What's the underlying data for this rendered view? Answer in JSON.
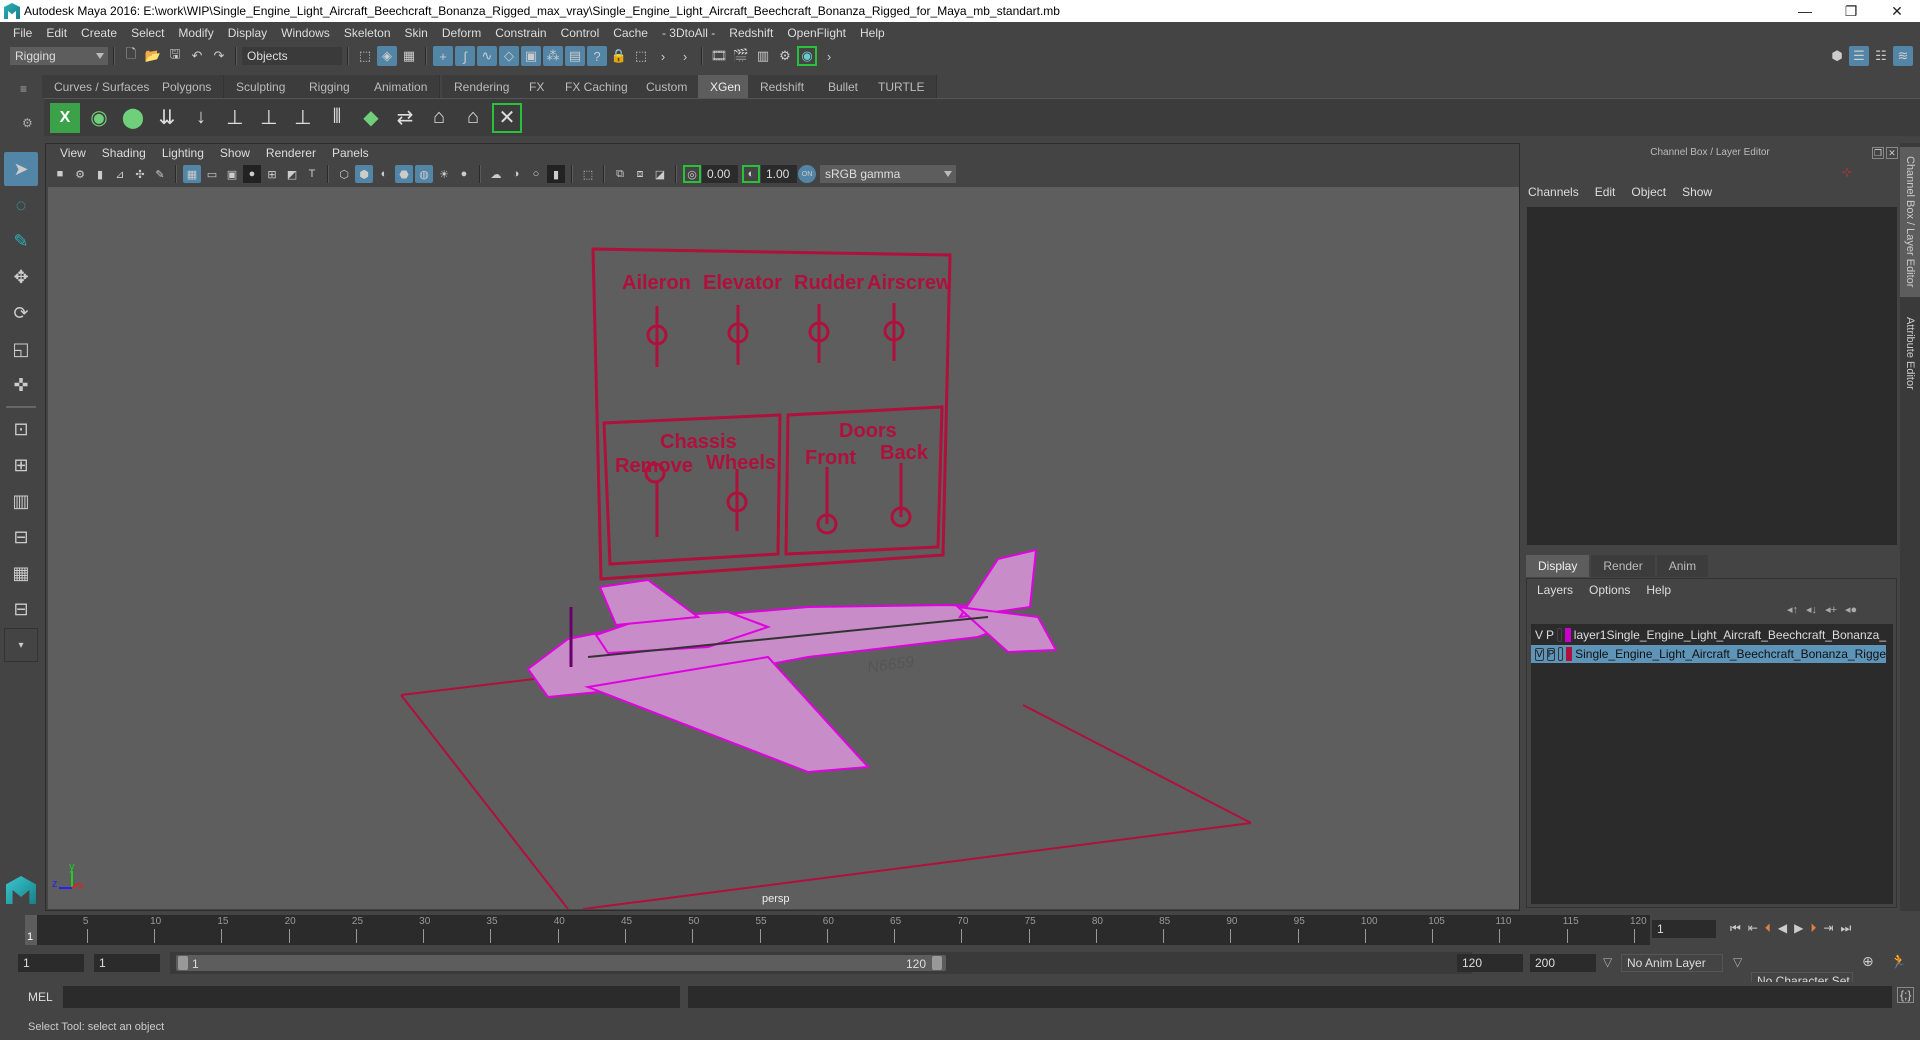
{
  "window": {
    "title": "Autodesk Maya 2016: E:\\work\\WIP\\Single_Engine_Light_Aircraft_Beechcraft_Bonanza_Rigged_max_vray\\Single_Engine_Light_Aircraft_Beechcraft_Bonanza_Rigged_for_Maya_mb_standart.mb",
    "minimize": "—",
    "restore": "❐",
    "close": "✕"
  },
  "menubar": [
    "File",
    "Edit",
    "Create",
    "Select",
    "Modify",
    "Display",
    "Windows",
    "Skeleton",
    "Skin",
    "Deform",
    "Constrain",
    "Control",
    "Cache",
    "- 3DtoAll -",
    "Redshift",
    "OpenFlight",
    "Help"
  ],
  "statusline": {
    "mode": "Rigging",
    "selection_mask": "Objects"
  },
  "shelf": {
    "tabs": [
      "Curves / Surfaces",
      "Polygons",
      "Sculpting",
      "Rigging",
      "Animation",
      "Rendering",
      "FX",
      "FX Caching",
      "Custom",
      "XGen",
      "Redshift",
      "Bullet",
      "TURTLE"
    ],
    "active_tab": "XGen",
    "icons": [
      "xgen-editor-icon",
      "xgen-preview-icon",
      "xgen-clear-icon",
      "add-guides-icon",
      "place-guides-icon",
      "add-guide-icon",
      "sculpt-guide-icon",
      "lock-guide-icon",
      "split-guides-icon",
      "density-icon",
      "flip-guides-icon",
      "select-guides-icon",
      "guide-cv-icon",
      "xgen-toggle-icon"
    ]
  },
  "panel": {
    "menus": [
      "View",
      "Shading",
      "Lighting",
      "Show",
      "Renderer",
      "Panels"
    ],
    "exposure": "0.00",
    "gamma": "1.00",
    "color_space": "sRGB gamma",
    "camera_label": "persp"
  },
  "scene": {
    "control_board": {
      "top_labels": [
        "Aileron",
        "Elevator",
        "Rudder",
        "Airscrew"
      ],
      "chassis_title": "Chassis",
      "chassis_labels": [
        "Remove",
        "Wheels"
      ],
      "doors_title": "Doors",
      "doors_labels": [
        "Front",
        "Back"
      ]
    },
    "tail_number": "N6659",
    "axis": {
      "x": "x",
      "y": "y",
      "z": "z"
    },
    "wire_color": "#b0103c",
    "mesh_color": "#e000e0"
  },
  "channel_box": {
    "title": "Channel Box / Layer Editor",
    "menus": [
      "Channels",
      "Edit",
      "Object",
      "Show"
    ]
  },
  "layer_editor": {
    "tabs": [
      "Display",
      "Render",
      "Anim"
    ],
    "active_tab": "Display",
    "menus": [
      "Layers",
      "Options",
      "Help"
    ],
    "layers": [
      {
        "v": "V",
        "p": "P",
        "color": "#cc00cc",
        "name": "layer1Single_Engine_Light_Aircraft_Beechcraft_Bonanza_",
        "selected": false
      },
      {
        "v": "V",
        "p": "P",
        "color": "#b0103c",
        "name": "Single_Engine_Light_Aircraft_Beechcraft_Bonanza_Rigge",
        "selected": true
      }
    ]
  },
  "side_tabs": [
    "Channel Box / Layer Editor",
    "Attribute Editor"
  ],
  "timeline": {
    "ticks": [
      "5",
      "10",
      "15",
      "20",
      "25",
      "30",
      "35",
      "40",
      "45",
      "50",
      "55",
      "60",
      "65",
      "70",
      "75",
      "80",
      "85",
      "90",
      "95",
      "100",
      "105",
      "110",
      "115",
      "120"
    ],
    "current_frame_marker": "1",
    "current_frame": "1",
    "start": 1,
    "end": 120
  },
  "range": {
    "start_time": "1",
    "playback_start": "1",
    "range_start_label": "1",
    "range_end_label": "120",
    "playback_end": "120",
    "end_time": "200",
    "anim_layer": "No Anim Layer",
    "character_set": "No Character Set"
  },
  "command_line": {
    "language": "MEL",
    "input": "",
    "output": ""
  },
  "help_line": "Select Tool: select an object"
}
